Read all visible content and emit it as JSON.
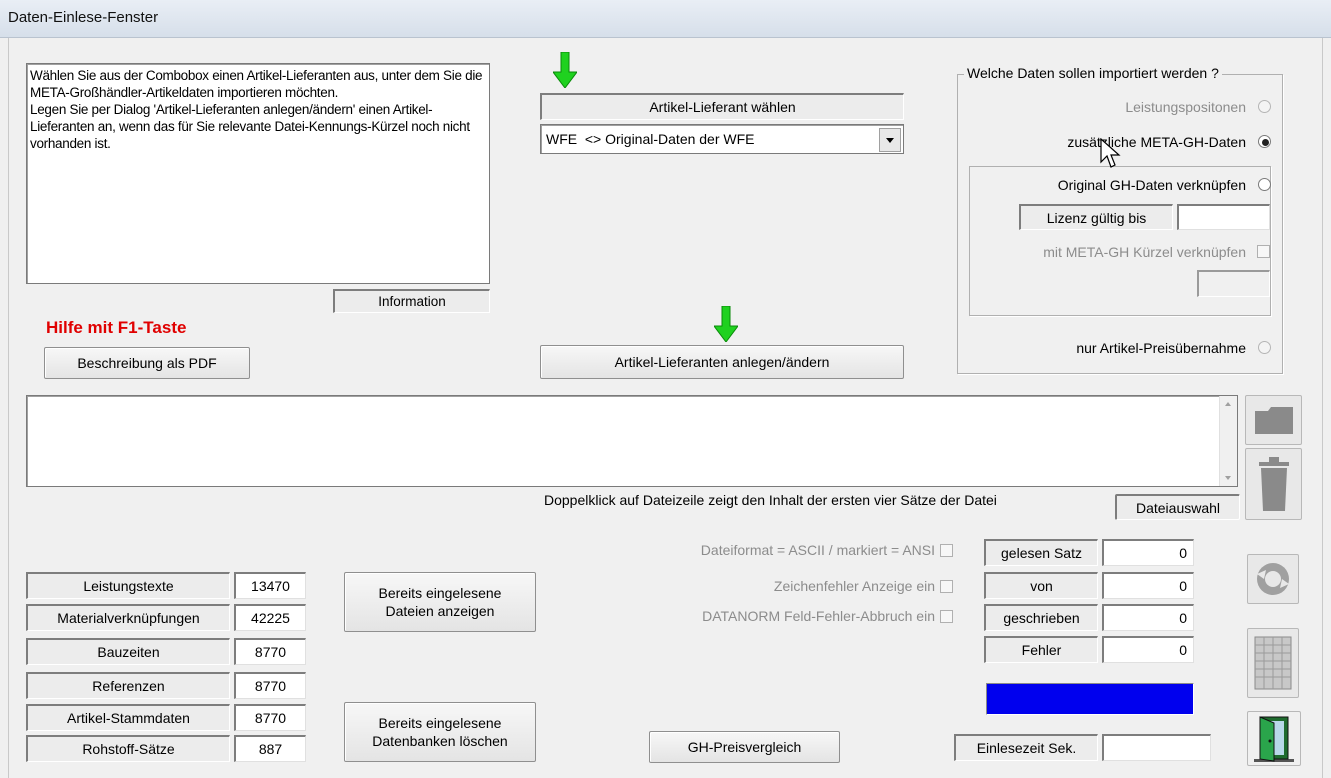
{
  "window": {
    "title": "Daten-Einlese-Fenster"
  },
  "info": {
    "text": "Wählen Sie aus der Combobox einen Artikel-Lieferanten aus, unter dem Sie die META-Großhändler-Artikeldaten importieren möchten.\nLegen Sie per Dialog 'Artikel-Lieferanten anlegen/ändern' einen Artikel-Lieferanten an, wenn das für Sie relevante Datei-Kennungs-Kürzel noch nicht vorhanden ist.",
    "label": "Information"
  },
  "help": {
    "f1_text": "Hilfe mit F1-Taste",
    "pdf_button": "Beschreibung als PDF"
  },
  "supplier": {
    "label": "Artikel-Lieferant wählen",
    "selected": "WFE  <> Original-Daten der WFE",
    "manage_button": "Artikel-Lieferanten anlegen/ändern",
    "arrow_color": "#1fd11f"
  },
  "import": {
    "legend": "Welche Daten sollen importiert werden ?",
    "leistungspositionen": "Leistungspositonen",
    "meta_gh": "zusätzliche META-GH-Daten",
    "original_gh": "Original GH-Daten verknüpfen",
    "license_label": "Lizenz gültig bis",
    "license_value": "",
    "meta_kuerzel": "mit META-GH Kürzel verknüpfen",
    "kuerzel_value": "",
    "preis": "nur Artikel-Preisübernahme",
    "selected": "meta_gh"
  },
  "files": {
    "hint": "Doppelklick auf Dateizeile zeigt den Inhalt der ersten vier Sätze der Datei",
    "select_button": "Dateiauswahl"
  },
  "stats": [
    {
      "label": "Leistungstexte",
      "value": "13470"
    },
    {
      "label": "Materialverknüpfungen",
      "value": "42225"
    },
    {
      "label": "Bauzeiten",
      "value": "8770"
    },
    {
      "label": "Referenzen",
      "value": "8770"
    },
    {
      "label": "Artikel-Stammdaten",
      "value": "8770"
    },
    {
      "label": "Rohstoff-Sätze",
      "value": "887"
    }
  ],
  "buttons": {
    "show_files_1": "Bereits eingelesene",
    "show_files_2": "Dateien anzeigen",
    "delete_db_1": "Bereits eingelesene",
    "delete_db_2": "Datenbanken löschen",
    "price_compare": "GH-Preisvergleich"
  },
  "options": [
    {
      "label": "Dateiformat = ASCII / markiert = ANSI"
    },
    {
      "label": "Zeichenfehler Anzeige ein"
    },
    {
      "label": "DATANORM Feld-Fehler-Abbruch ein"
    }
  ],
  "counters": [
    {
      "label": "gelesen Satz",
      "value": "0"
    },
    {
      "label": "von",
      "value": "0"
    },
    {
      "label": "geschrieben",
      "value": "0"
    },
    {
      "label": "Fehler",
      "value": "0"
    }
  ],
  "progress": {
    "fraction": 1.0,
    "color": "#0000ee"
  },
  "timer": {
    "label": "Einlesezeit Sek.",
    "value": ""
  }
}
